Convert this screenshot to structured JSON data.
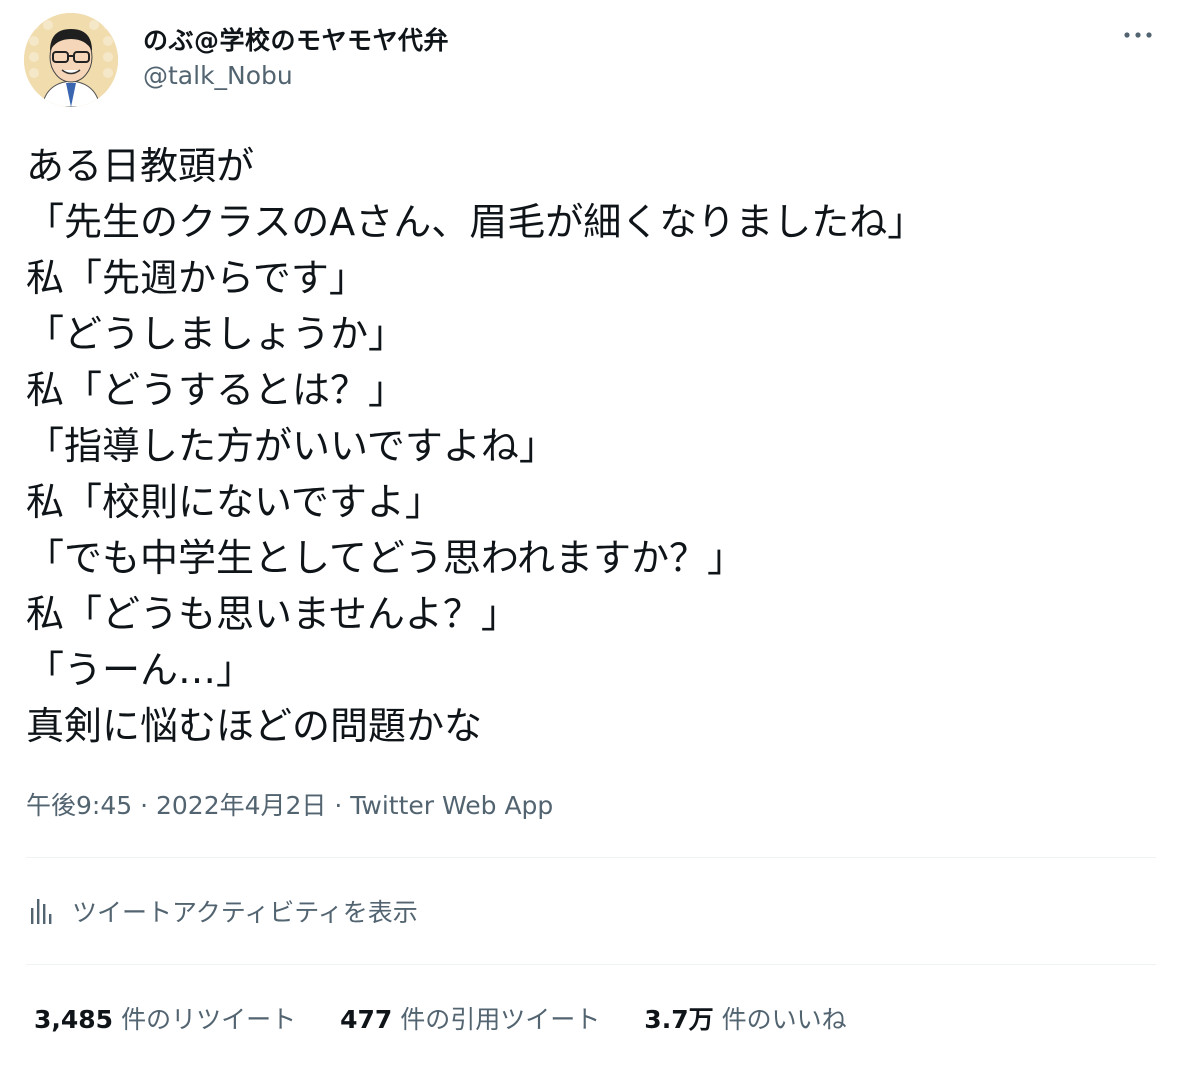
{
  "author": {
    "display_name": "のぶ@学校のモヤモヤ代弁",
    "handle": "@talk_Nobu",
    "avatar_icon": "avatar-illustration"
  },
  "more_icon": "more-horizontal-icon",
  "tweet_lines": [
    "ある日教頭が",
    "「先生のクラスのAさん、眉毛が細くなりましたね」",
    "私「先週からです」",
    "「どうしましょうか」",
    "私「どうするとは？」",
    "「指導した方がいいですよね」",
    "私「校則にないですよ」",
    "「でも中学生としてどう思われますか？」",
    "私「どうも思いませんよ？」",
    "「うーん…」",
    "真剣に悩むほどの問題かな"
  ],
  "meta": {
    "time": "午後9:45",
    "separator": " · ",
    "date": "2022年4月2日",
    "source": "Twitter Web App"
  },
  "activity": {
    "label": "ツイートアクティビティを表示",
    "icon": "analytics-bar-icon"
  },
  "stats": {
    "retweets": {
      "count": "3,485",
      "label": "件のリツイート"
    },
    "quotes": {
      "count": "477",
      "label": "件の引用ツイート"
    },
    "likes": {
      "count": "3.7万",
      "label": "件のいいね"
    }
  },
  "colors": {
    "text": "#0f1419",
    "secondary": "#536471",
    "divider": "#eff3f4"
  }
}
